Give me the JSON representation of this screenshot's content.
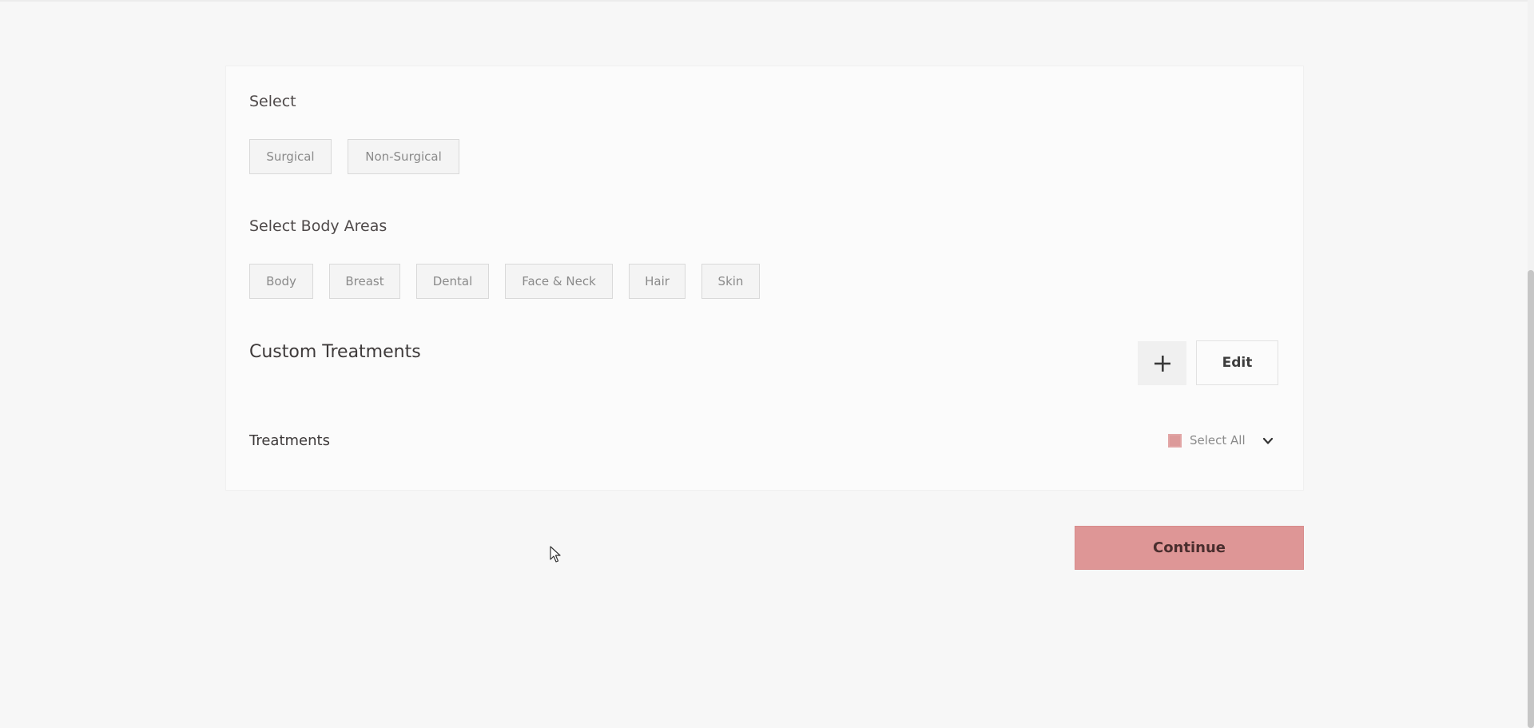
{
  "sections": {
    "select_label": "Select",
    "select_options": [
      "Surgical",
      "Non-Surgical"
    ],
    "body_areas_label": "Select Body Areas",
    "body_areas": [
      "Body",
      "Breast",
      "Dental",
      "Face & Neck",
      "Hair",
      "Skin"
    ]
  },
  "custom": {
    "title": "Custom Treatments",
    "add_icon": "plus-icon",
    "edit_label": "Edit"
  },
  "treatments": {
    "label": "Treatments",
    "select_all_label": "Select All",
    "select_all_checked": true,
    "chevron_icon": "chevron-down-icon"
  },
  "footer": {
    "continue_label": "Continue"
  },
  "colors": {
    "accent": "#de9696",
    "checkbox": "#dc9a9a"
  }
}
